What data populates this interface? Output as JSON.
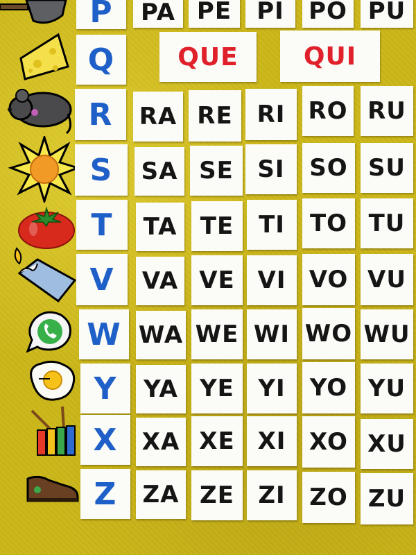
{
  "rows": [
    {
      "letter": "P",
      "syllables": [
        "PA",
        "PE",
        "PI",
        "PO",
        "PU"
      ],
      "icon": "shovel-icon"
    },
    {
      "letter": "Q",
      "syllables": [
        "QUE",
        "QUI"
      ],
      "icon": "cheese-icon"
    },
    {
      "letter": "R",
      "syllables": [
        "RA",
        "RE",
        "RI",
        "RO",
        "RU"
      ],
      "icon": "rat-icon"
    },
    {
      "letter": "S",
      "syllables": [
        "SA",
        "SE",
        "SI",
        "SO",
        "SU"
      ],
      "icon": "sun-icon"
    },
    {
      "letter": "T",
      "syllables": [
        "TA",
        "TE",
        "TI",
        "TO",
        "TU"
      ],
      "icon": "tomato-icon"
    },
    {
      "letter": "V",
      "syllables": [
        "VA",
        "VE",
        "VI",
        "VO",
        "VU"
      ],
      "icon": "candle-icon"
    },
    {
      "letter": "W",
      "syllables": [
        "WA",
        "WE",
        "WI",
        "WO",
        "WU"
      ],
      "icon": "whatsapp-icon"
    },
    {
      "letter": "Y",
      "syllables": [
        "YA",
        "YE",
        "YI",
        "YO",
        "YU"
      ],
      "icon": "fried-egg-icon"
    },
    {
      "letter": "X",
      "syllables": [
        "XA",
        "XE",
        "XI",
        "XO",
        "XU"
      ],
      "icon": "xylophone-icon"
    },
    {
      "letter": "Z",
      "syllables": [
        "ZA",
        "ZE",
        "ZI",
        "ZO",
        "ZU"
      ],
      "icon": "shoe-icon"
    }
  ],
  "colors": {
    "letter": "#1f5fc8",
    "syllable": "#151515",
    "qu_syllable": "#e0202a",
    "felt_background": "#cdb81c"
  }
}
